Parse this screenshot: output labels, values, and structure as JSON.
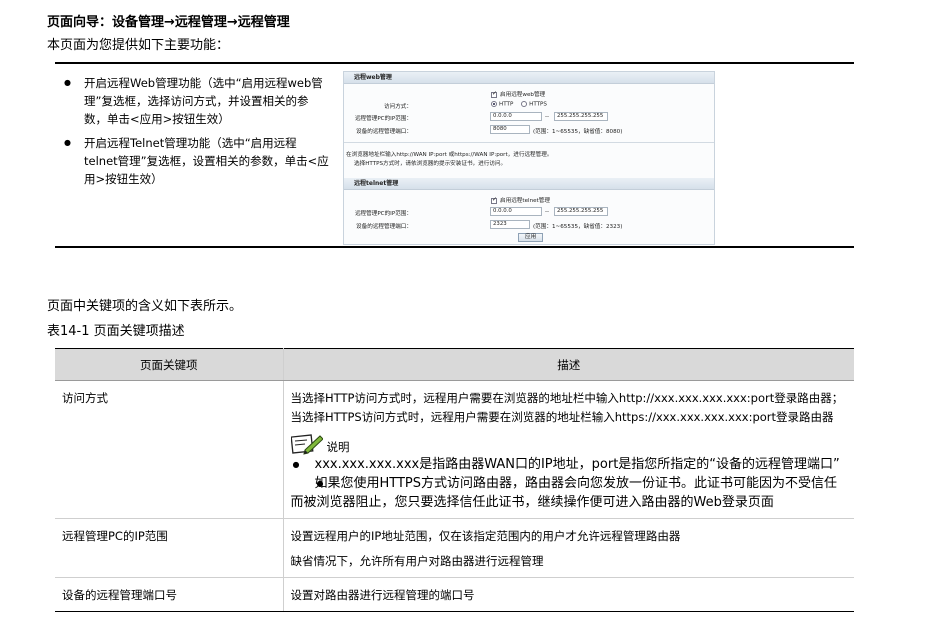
{
  "header": {
    "nav_title": "页面向导：设备管理→远程管理→远程管理",
    "intro": "本页面为您提供如下主要功能："
  },
  "features": [
    {
      "text": "开启远程Web管理功能（选中“启用远程web管理”复选框，选择访问方式，并设置相关的参数，单击<应用>按钮生效）"
    },
    {
      "text": "开启远程Telnet管理功能（选中“启用远程telnet管理”复选框，设置相关的参数，单击<应用>按钮生效）"
    }
  ],
  "screenshot": {
    "web_section": "远程web管理",
    "web_enable": "启用远程web管理",
    "access_label": "访问方式：",
    "http": "HTTP",
    "https": "HTTPS",
    "ip_range_label": "远程管理PC的IP范围：",
    "ip_start": "0.0.0.0",
    "ip_dash": "--",
    "ip_end": "255.255.255.255",
    "port_label": "设备的远程管理端口：",
    "web_port": "8080",
    "web_port_hint": "(范围：1~65535，缺省值：8080)",
    "hint_line1": "在浏览器地址栏输入http://WAN IP:port 或https://WAN IP:port，进行远程管理。",
    "hint_line2": "选择HTTPS方式时，请依浏览器的提示安装证书，进行访问。",
    "telnet_section": "远程telnet管理",
    "telnet_enable": "启用远程telnet管理",
    "telnet_ip_label": "远程管理PC的IP范围：",
    "telnet_port_label": "设备的远程管理端口：",
    "telnet_port": "2323",
    "telnet_port_hint": "(范围：1~65535，缺省值：2323)",
    "apply": "应用"
  },
  "para2": "页面中关键项的含义如下表所示。",
  "table_caption": "表14-1 页面关键项描述",
  "table": {
    "headers": [
      "页面关键项",
      "描述"
    ],
    "rows": [
      {
        "key": "访问方式",
        "desc": "当选择HTTP访问方式时，远程用户需要在浏览器的地址栏中输入http://xxx.xxx.xxx.xxx:port登录路由器；当选择HTTPS访问方式时，远程用户需要在浏览器的地址栏输入https://xxx.xxx.xxx.xxx:port登录路由器",
        "note_label": "说明",
        "notes": [
          "xxx.xxx.xxx.xxx是指路由器WAN口的IP地址，port是指您所指定的“设备的远程管理端口”",
          "如果您使用HTTPS方式访问路由器，路由器会向您发放一份证书。此证书可能因为不受信任而被浏览器阻止，您只要选择信任此证书，继续操作便可进入路由器的Web登录页面"
        ]
      },
      {
        "key": "远程管理PC的IP范围",
        "desc1": "设置远程用户的IP地址范围，仅在该指定范围内的用户才允许远程管理路由器",
        "desc2": "缺省情况下，允许所有用户对路由器进行远程管理"
      },
      {
        "key": "设备的远程管理端口号",
        "desc": "设置对路由器进行远程管理的端口号"
      }
    ]
  }
}
